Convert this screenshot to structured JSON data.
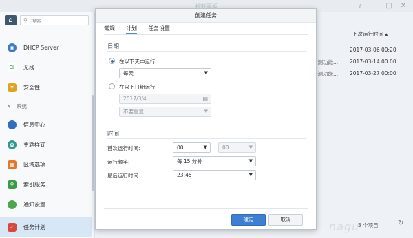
{
  "background": {
    "window_title": "控制面板",
    "search_placeholder": "搜索",
    "sidebar": {
      "items": [
        {
          "label": "DHCP Server",
          "icon": "dhcp-icon",
          "color": "#3a7bc8"
        },
        {
          "label": "无线",
          "icon": "wifi-icon",
          "color": "#3aa76d"
        },
        {
          "label": "安全性",
          "icon": "shield-icon",
          "color": "#e0a020"
        },
        {
          "label": "信息中心",
          "icon": "info-icon",
          "color": "#2f6fc1"
        },
        {
          "label": "主题样式",
          "icon": "palette-icon",
          "color": "#2f9a8c"
        },
        {
          "label": "区域选项",
          "icon": "calendar-icon",
          "color": "#e07a2a"
        },
        {
          "label": "索引服务",
          "icon": "search-index-icon",
          "color": "#3a9a4a"
        },
        {
          "label": "通知设置",
          "icon": "chat-icon",
          "color": "#4aa84a"
        },
        {
          "label": "任务计划",
          "icon": "task-schedule-icon",
          "color": "#d9463a"
        }
      ],
      "section_label": "系统"
    },
    "table": {
      "header": "下次运行时间",
      "rows": [
        {
          "col_a": "",
          "next_run": "2017-03-06 00:20"
        },
        {
          "col_a": "检测功能...",
          "next_run": "2017-03-14 00:00"
        },
        {
          "col_a": "检测功能...",
          "next_run": "2017-03-27 00:00"
        }
      ],
      "footer": "3 个项目"
    }
  },
  "dialog": {
    "title": "创建任务",
    "tabs": [
      "常规",
      "计划",
      "任务设置"
    ],
    "active_tab": "计划",
    "date_section": {
      "title": "日期",
      "option_daily_label": "在以下天中运行",
      "daily_value": "每天",
      "option_date_label": "在以下日期运行",
      "date_value": "2017/3/4",
      "repeat_value": "不要重复"
    },
    "time_section": {
      "title": "时间",
      "first_run_label": "首次运行时间:",
      "first_run_hour": "00",
      "first_run_minute": "00",
      "frequency_label": "运行频率:",
      "frequency_value": "每 15 分钟",
      "last_run_label": "最后运行时间:",
      "last_run_value": "23:45"
    },
    "ok_label": "确定",
    "cancel_label": "取消"
  },
  "watermark": "nagu",
  "colors": {
    "accent": "#3d7fd3",
    "active_sidebar": "#d8e7f6"
  }
}
